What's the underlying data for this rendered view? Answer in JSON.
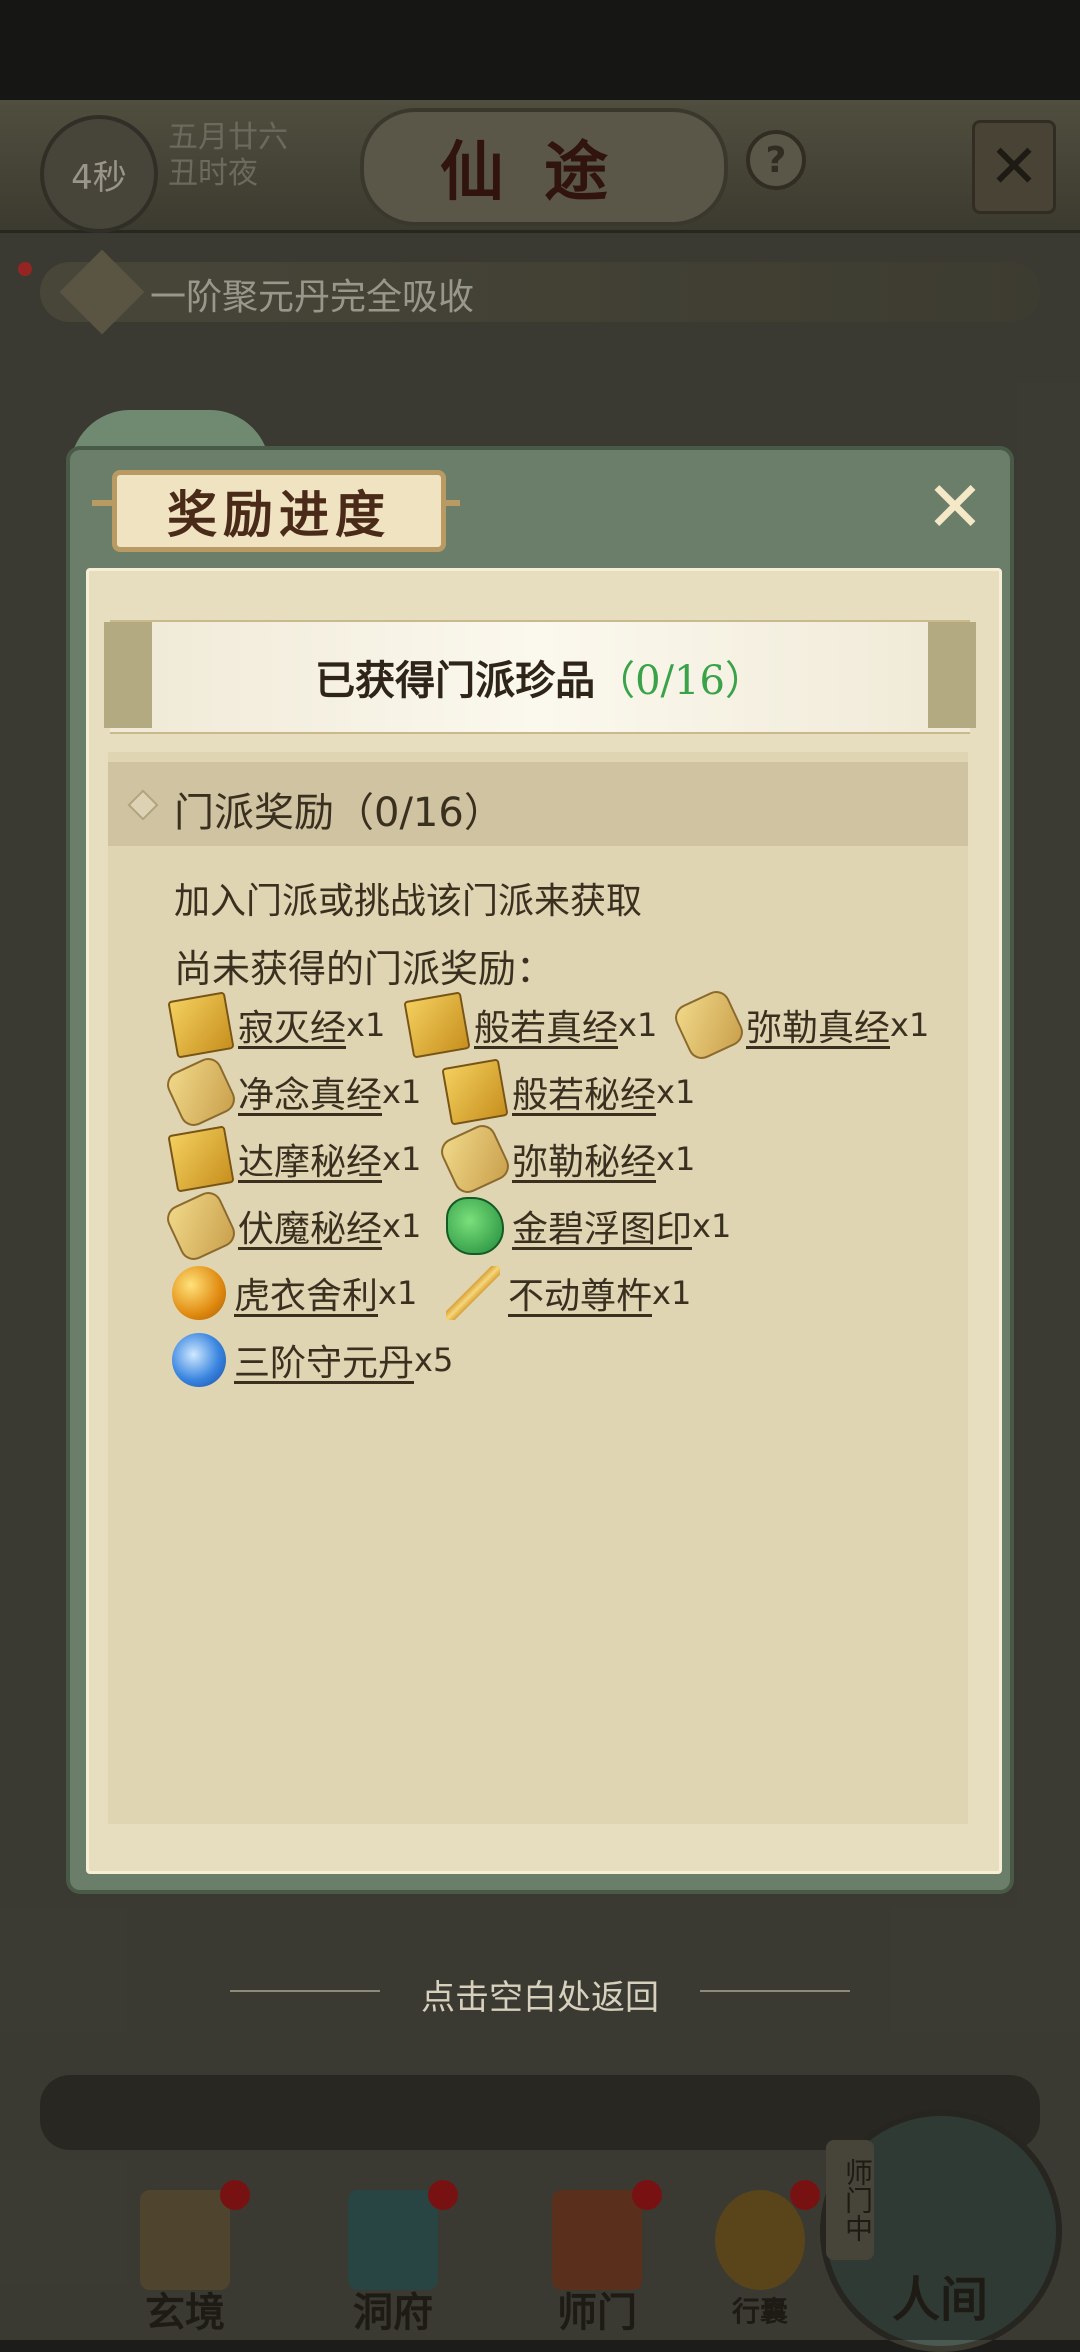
{
  "header": {
    "timer": "4秒",
    "date_line1": "五月廿六",
    "date_line2": "丑时夜",
    "title": "仙途",
    "help": "?"
  },
  "notice": {
    "text": "一阶聚元丹完全吸收"
  },
  "dialog": {
    "title": "奖励进度",
    "close": "✕",
    "banner_label": "已获得门派珍品",
    "banner_count": "（0/16）",
    "section_title": "门派奖励（0/16）",
    "description": "加入门派或挑战该门派来获取",
    "subheading": "尚未获得的门派奖励：",
    "items": [
      {
        "name": "寂灭经",
        "qty": "x1",
        "icon": "book-icon"
      },
      {
        "name": "般若真经",
        "qty": "x1",
        "icon": "book-icon"
      },
      {
        "name": "弥勒真经",
        "qty": "x1",
        "icon": "scroll-icon"
      },
      {
        "name": "净念真经",
        "qty": "x1",
        "icon": "scroll-icon"
      },
      {
        "name": "般若秘经",
        "qty": "x1",
        "icon": "book-icon"
      },
      {
        "name": "达摩秘经",
        "qty": "x1",
        "icon": "book-icon"
      },
      {
        "name": "弥勒秘经",
        "qty": "x1",
        "icon": "scroll-icon"
      },
      {
        "name": "伏魔秘经",
        "qty": "x1",
        "icon": "scroll-icon"
      },
      {
        "name": "金碧浮图印",
        "qty": "x1",
        "icon": "jade-seal-icon"
      },
      {
        "name": "虎衣舍利",
        "qty": "x1",
        "icon": "relic-orb-icon"
      },
      {
        "name": "不动尊杵",
        "qty": "x1",
        "icon": "vajra-icon"
      },
      {
        "name": "三阶守元丹",
        "qty": "x5",
        "icon": "pill-icon"
      }
    ]
  },
  "return_hint": "点击空白处返回",
  "nav": {
    "items": [
      "玄境",
      "洞府",
      "师门",
      "行囊"
    ],
    "side_tag": "师门中",
    "main": "人间"
  },
  "colors": {
    "accent_green": "#3aa34a",
    "badge_red": "#b81d1d",
    "dialog_frame": "#6b7e6a",
    "paper": "#e7dec0"
  }
}
